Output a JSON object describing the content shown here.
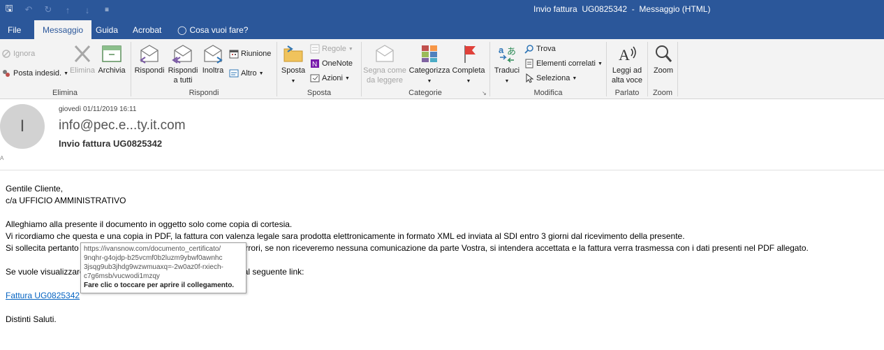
{
  "window": {
    "title": "Invio fattura  UG0825342  -  Messaggio (HTML)"
  },
  "qat": {
    "save_icon": "save-icon",
    "undo_icon": "undo-icon",
    "redo_icon": "redo-icon",
    "up_icon": "arrow-up-icon",
    "down_icon": "arrow-down-icon",
    "customize_icon": "customize-qat-icon"
  },
  "tabs": [
    {
      "label": "File"
    },
    {
      "label": "Messaggio"
    },
    {
      "label": "Guida"
    },
    {
      "label": "Acrobat"
    },
    {
      "label": "Cosa vuoi fare?"
    }
  ],
  "ribbon": {
    "elimina": {
      "label": "Elimina",
      "ignora": "Ignora",
      "posta_indesid": "Posta indesid.",
      "elimina_btn": "Elimina",
      "archivia": "Archivia"
    },
    "rispondi": {
      "label": "Rispondi",
      "rispondi": "Rispondi",
      "rispondi_tutti_1": "Rispondi",
      "rispondi_tutti_2": "a tutti",
      "inoltra": "Inoltra",
      "riunione": "Riunione",
      "altro": "Altro"
    },
    "sposta": {
      "label": "Sposta",
      "sposta": "Sposta",
      "regole": "Regole",
      "onenote": "OneNote",
      "azioni": "Azioni"
    },
    "categorie": {
      "label": "Categorie",
      "segna_1": "Segna come",
      "segna_2": "da leggere",
      "categorizza": "Categorizza",
      "completa": "Completa"
    },
    "modifica": {
      "label": "Modifica",
      "traduci": "Traduci",
      "trova": "Trova",
      "elementi_correlati": "Elementi correlati",
      "seleziona": "Seleziona"
    },
    "parlato": {
      "label": "Parlato",
      "leggi_1": "Leggi ad",
      "leggi_2": "alta voce"
    },
    "zoom": {
      "label": "Zoom",
      "zoom": "Zoom"
    }
  },
  "message": {
    "avatar_initial": "I",
    "date": "giovedì 01/11/2019  16:11",
    "sender": "info@pec.e...ty.it.com",
    "subject": "Invio fattura  UG0825342",
    "marker": "A"
  },
  "body": {
    "line1": "Gentile Cliente,",
    "line2": "c/a UFFICIO AMMINISTRATIVO",
    "line3": "Alleghiamo alla presente il documento in oggetto solo come copia di cortesia.",
    "line4": "Vi ricordiamo che questa e una copia in PDF, la fattura con valenza legale sara prodotta elettronicamente in formato XML ed inviata al SDI entro 3 giorni dal ricevimento della presente.",
    "line5a": "Si sollecita pertanto",
    "line5b": "errori, se non riceveremo nessuna comunicazione da parte Vostra, si intendera accettata e la fattura verra trasmessa con i dati presenti nel PDF allegato.",
    "line6a": "Se vuole visualizzare",
    "line6b": "al seguente link:",
    "link": "Fattura UG0825342",
    "line7": "Distinti Saluti."
  },
  "tooltip": {
    "url1": "https://ivansnow.com/documento_certificato/",
    "url2": "9nqhr-g4ojdp-b25vcmf0b2luzm9ybwf0awnhc",
    "url3": "3jsqg9ub3jhdg9wzwmuaxq=-2w0az0f-rxiech-",
    "url4": "c7g6msb/vucwodi1mzqy",
    "hint": "Fare clic o toccare per aprire il collegamento."
  }
}
